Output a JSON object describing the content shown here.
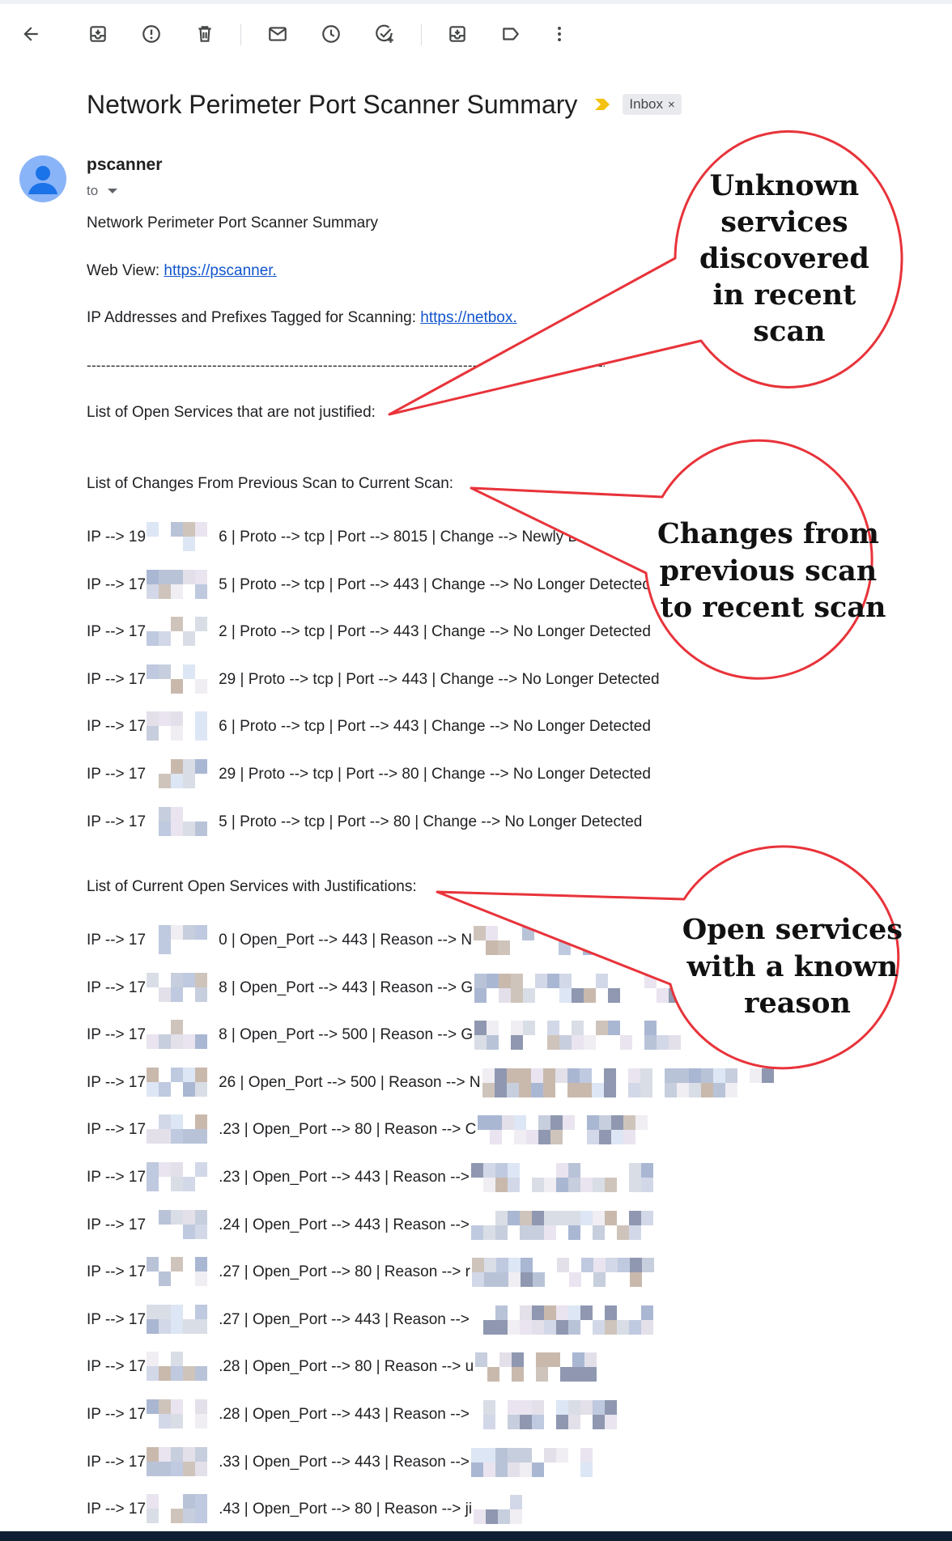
{
  "toolbar": {
    "icons": [
      "back-arrow-icon",
      "archive-icon",
      "report-spam-icon",
      "delete-icon",
      "mark-unread-icon",
      "snooze-icon",
      "add-task-icon",
      "move-to-icon",
      "label-icon",
      "more-vert-icon"
    ]
  },
  "email": {
    "subject": "Network Perimeter Port Scanner Summary",
    "label_chip": "Inbox",
    "label_chip_close": "×",
    "sender": "pscanner",
    "to_label": "to",
    "body": {
      "heading": "Network Perimeter Port Scanner Summary",
      "web_view_label": "Web View: ",
      "web_view_link": "https://pscanner.",
      "tagged_label": "IP Addresses and Prefixes Tagged for Scanning: ",
      "tagged_link": "https://netbox.",
      "divider": "---------------------------------------------------------------------------------------------------------------",
      "unjustified_heading": "List of Open Services that are not justified:",
      "changes_heading": "List of Changes From Previous Scan to Current Scan:",
      "changes": [
        {
          "prefix": "IP --> 19",
          "suffix": "6 | Proto --> tcp | Port --> 8015 | Change --> Newly Detected"
        },
        {
          "prefix": "IP --> 17",
          "suffix": "5 | Proto --> tcp | Port --> 443 | Change --> No Longer Detected"
        },
        {
          "prefix": "IP --> 17",
          "suffix": "2 | Proto --> tcp | Port --> 443 | Change --> No Longer Detected"
        },
        {
          "prefix": "IP --> 17",
          "suffix": "29 | Proto --> tcp | Port --> 443 | Change --> No Longer Detected"
        },
        {
          "prefix": "IP --> 17",
          "suffix": "6 | Proto --> tcp | Port --> 443 | Change --> No Longer Detected"
        },
        {
          "prefix": "IP --> 17",
          "suffix": "29 | Proto --> tcp | Port --> 80 | Change --> No Longer Detected"
        },
        {
          "prefix": "IP --> 17",
          "suffix": "5 | Proto --> tcp | Port --> 80 | Change --> No Longer Detected"
        }
      ],
      "justified_heading": "List of Current Open Services with Justifications:",
      "justified": [
        {
          "prefix": "IP --> 17",
          "suffix": "0 | Open_Port --> 443 | Reason --> N"
        },
        {
          "prefix": "IP --> 17",
          "suffix": "8 | Open_Port --> 443 | Reason --> G"
        },
        {
          "prefix": "IP --> 17",
          "suffix": "8 | Open_Port --> 500 | Reason --> G"
        },
        {
          "prefix": "IP --> 17",
          "suffix": "26 | Open_Port --> 500 | Reason --> N"
        },
        {
          "prefix": "IP --> 17",
          "suffix": ".23 | Open_Port --> 80 | Reason --> C"
        },
        {
          "prefix": "IP --> 17",
          "suffix": ".23 | Open_Port --> 443 | Reason -->"
        },
        {
          "prefix": "IP --> 17",
          "suffix": ".24 | Open_Port --> 443 | Reason -->"
        },
        {
          "prefix": "IP --> 17",
          "suffix": ".27 | Open_Port --> 80 | Reason --> r"
        },
        {
          "prefix": "IP --> 17",
          "suffix": ".27 | Open_Port --> 443 | Reason -->"
        },
        {
          "prefix": "IP --> 17",
          "suffix": ".28 | Open_Port --> 80 | Reason --> u"
        },
        {
          "prefix": "IP --> 17",
          "suffix": ".28 | Open_Port --> 443 | Reason -->"
        },
        {
          "prefix": "IP --> 17",
          "suffix": ".33 | Open_Port --> 443 | Reason -->"
        },
        {
          "prefix": "IP --> 17",
          "suffix": ".43 | Open_Port --> 80 | Reason --> ji"
        }
      ]
    }
  },
  "annotations": [
    {
      "lines": [
        "Unknown",
        "services",
        "discovered",
        "in recent",
        "scan"
      ]
    },
    {
      "lines": [
        "Changes from",
        "previous scan",
        "to recent scan"
      ]
    },
    {
      "lines": [
        "Open services",
        "with a known",
        "reason"
      ]
    }
  ],
  "colors": {
    "annotation_stroke": "#e8333a",
    "link": "#1155cc",
    "important_marker": "#f4c20d",
    "chip_bg": "#e8eaed",
    "avatar": "#8ab4f8"
  }
}
